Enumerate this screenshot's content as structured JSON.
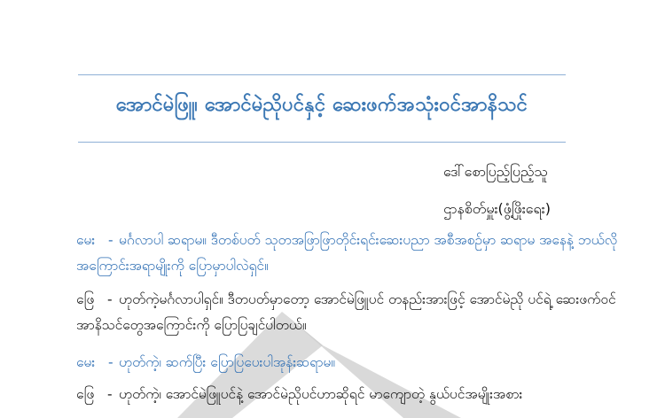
{
  "document": {
    "title": "အောင်မဲဖြူ၊ အောင်မဲညိုပင်နှင့် ဆေးဖက်အသုံးဝင်အာနိသင်",
    "author_name": "ဒေါ်စောပြည့်ပြည့်သူ",
    "author_org": "ဌာနစိတ်မှူး(ဖွံ့ဖြိုးရေး)",
    "dialogue": [
      {
        "speaker": "မေး",
        "dash": "-",
        "text": "မင်္ဂလာပါ ဆရာမ။ ဒီတစ်ပတ် သုတအဖြာဖြာတိုင်းရင်းဆေးပညာ အစီအစဉ်မှာ ဆရာမ အနေနဲ့ ဘယ်လိုအကြောင်းအရာမျိုးကို ပြောမှာပါလဲရှင်။"
      },
      {
        "speaker": "ဖြေ",
        "dash": "-",
        "text": "ဟုတ်ကဲ့မင်္ဂလာပါရှင်။ ဒီတပတ်မှာတော့ အောင်မဲဖြူပင် တနည်းအားဖြင့် အောင်မဲညို ပင်ရဲ့ ဆေးဖက်ဝင်အာနိသင်တွေအကြောင်းကို ပြောပြချင်ပါတယ်။"
      },
      {
        "speaker": "မေး",
        "dash": "-",
        "text": "ဟုတ်ကဲ့၊ ဆက်ပြီး ပြောပြပေးပါအုန်းဆရာမ။"
      },
      {
        "speaker": "ဖြေ",
        "dash": "-",
        "text": "ဟုတ်ကဲ့၊ အောင်မဲဖြူပင်နဲ့ အောင်မဲညိုပင်ဟာဆိုရင် မာကျောတဲ့ နွယ်ပင်အမျိုးအစား"
      }
    ]
  },
  "colors": {
    "title": "#3c78b4",
    "question": "#2f6fb4",
    "answer": "#111111",
    "rule": "#8fb0d6",
    "watermark": "#cfcfcf"
  }
}
